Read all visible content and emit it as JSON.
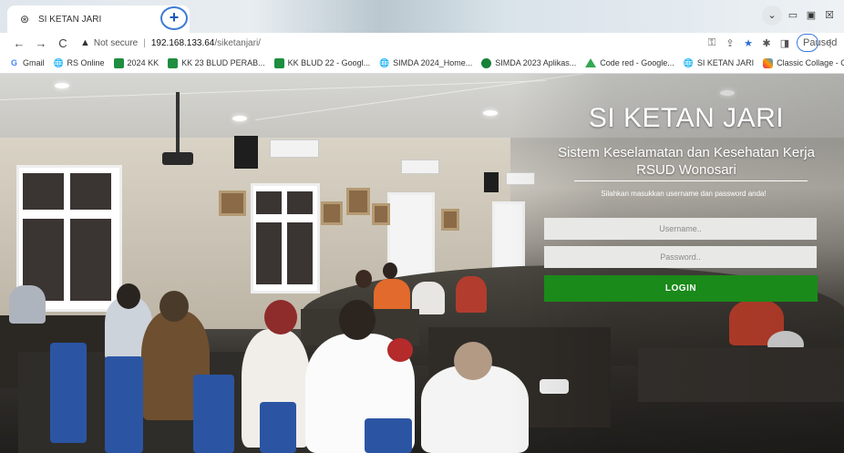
{
  "browser": {
    "tab": {
      "favicon": "globe-icon",
      "title": "SI KETAN JARI",
      "close": "×"
    },
    "new_tab": "+",
    "nav": {
      "back": "←",
      "forward": "→",
      "reload": "C"
    },
    "address": {
      "warning_icon": "warning-icon",
      "warning": "Not secure",
      "host": "192.168.133.64",
      "path": "/siketanjari/"
    },
    "profile": {
      "status": "Paused"
    },
    "bookmarks": [
      {
        "icon": "google-icon",
        "glyph": "G",
        "label": "Gmail"
      },
      {
        "icon": "globe-icon",
        "glyph": "🌐",
        "label": "RS Online"
      },
      {
        "icon": "sheets-icon",
        "glyph": "",
        "label": "2024 KK"
      },
      {
        "icon": "sheets-icon",
        "glyph": "",
        "label": "KK 23 BLUD PERAB..."
      },
      {
        "icon": "sheets-icon",
        "glyph": "",
        "label": "KK BLUD 22 - Googl..."
      },
      {
        "icon": "globe-icon",
        "glyph": "🌐",
        "label": "SIMDA 2024_Home..."
      },
      {
        "icon": "dot-icon",
        "glyph": "",
        "label": "SIMDA 2023 Aplikas..."
      },
      {
        "icon": "drive-icon",
        "glyph": "",
        "label": "Code red - Google..."
      },
      {
        "icon": "globe-icon",
        "glyph": "🌐",
        "label": "SI KETAN JARI"
      },
      {
        "icon": "collage-icon",
        "glyph": "",
        "label": "Classic Collage - Co..."
      }
    ],
    "more": "»"
  },
  "login": {
    "title": "SI KETAN JARI",
    "subtitle_line1": "Sistem Keselamatan dan Kesehatan Kerja",
    "subtitle_line2": "RSUD Wonosari",
    "hint": "Silahkan masukkan username dan password anda!",
    "username_placeholder": "Username..",
    "password_placeholder": "Password..",
    "button": "LOGIN"
  },
  "colors": {
    "login_button": "#1a8a1a",
    "input_bg": "#e8e8e6",
    "link_blue": "#3f7ae0"
  }
}
